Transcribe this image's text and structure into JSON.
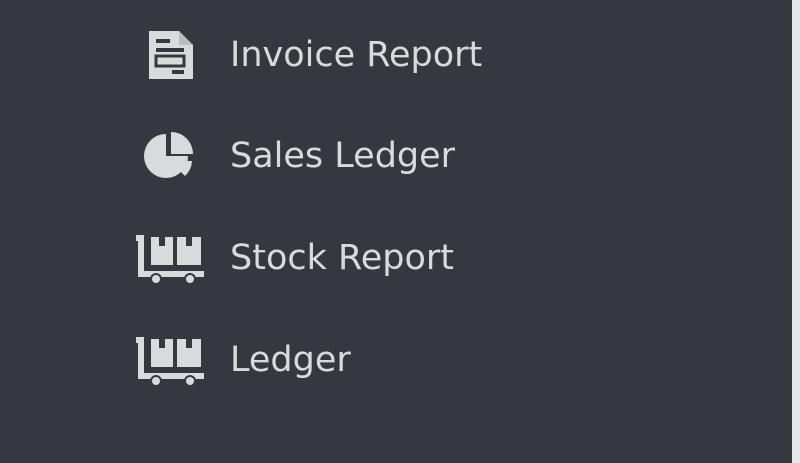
{
  "colors": {
    "background": "#35383e",
    "text": "#d9dadc",
    "icon": "#d9dadc",
    "scroll_edge": "#e6e7e9"
  },
  "sidebar": {
    "items": [
      {
        "label": "Invoice Report",
        "icon": "document-icon"
      },
      {
        "label": "Sales Ledger",
        "icon": "pie-chart-icon"
      },
      {
        "label": "Stock Report",
        "icon": "dolly-cart-icon"
      },
      {
        "label": "Ledger",
        "icon": "dolly-cart-icon"
      }
    ]
  }
}
